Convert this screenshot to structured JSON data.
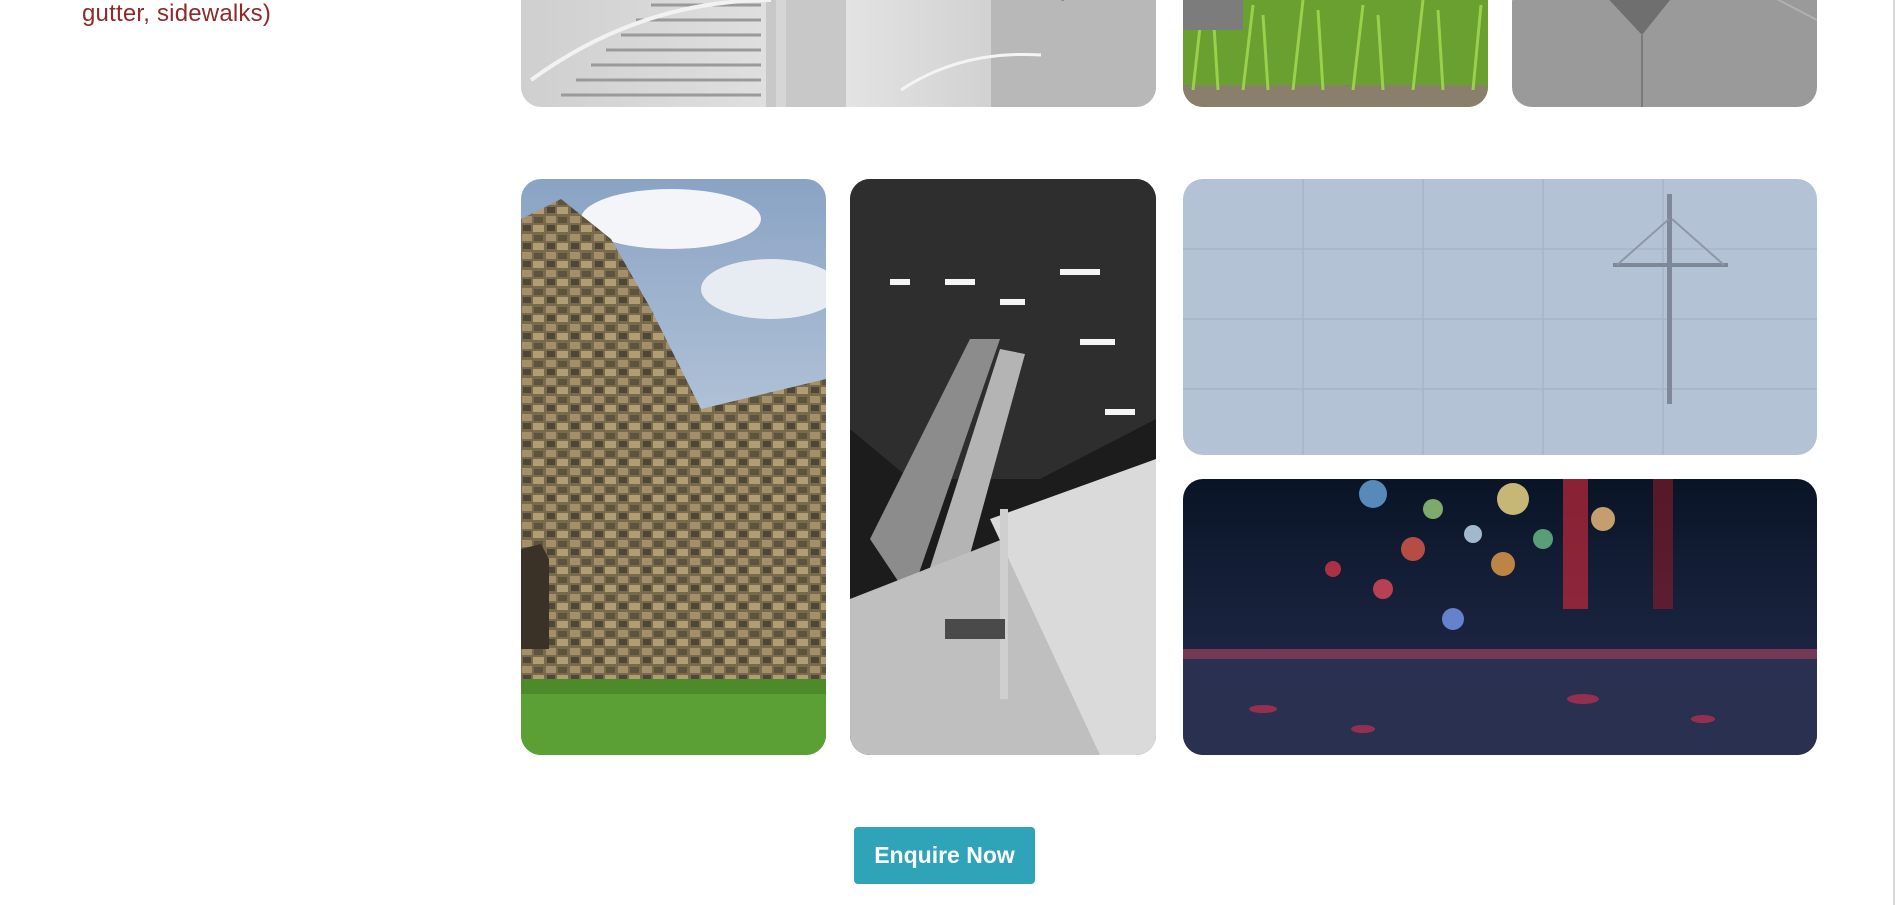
{
  "sidebar": {
    "text": "gutter, sidewalks)",
    "color": "#8e2a2a"
  },
  "gallery": {
    "tiles": [
      {
        "name": "stairs-photo",
        "subject": "grey spiral staircase interior"
      },
      {
        "name": "grass-photo",
        "subject": "green grass on gravel"
      },
      {
        "name": "pavement-photo",
        "subject": "grey pavement with drain cover"
      },
      {
        "name": "stone-wall-photo",
        "subject": "ruined stone wall with grass"
      },
      {
        "name": "escalator-photo",
        "subject": "black and white metro escalator"
      },
      {
        "name": "concrete-cross-photo",
        "subject": "concrete wall with cross"
      },
      {
        "name": "bokeh-photo",
        "subject": "wet pavement with colorful bokeh lights"
      }
    ]
  },
  "cta": {
    "label": "Enquire Now",
    "color": "#2fa3b8"
  }
}
